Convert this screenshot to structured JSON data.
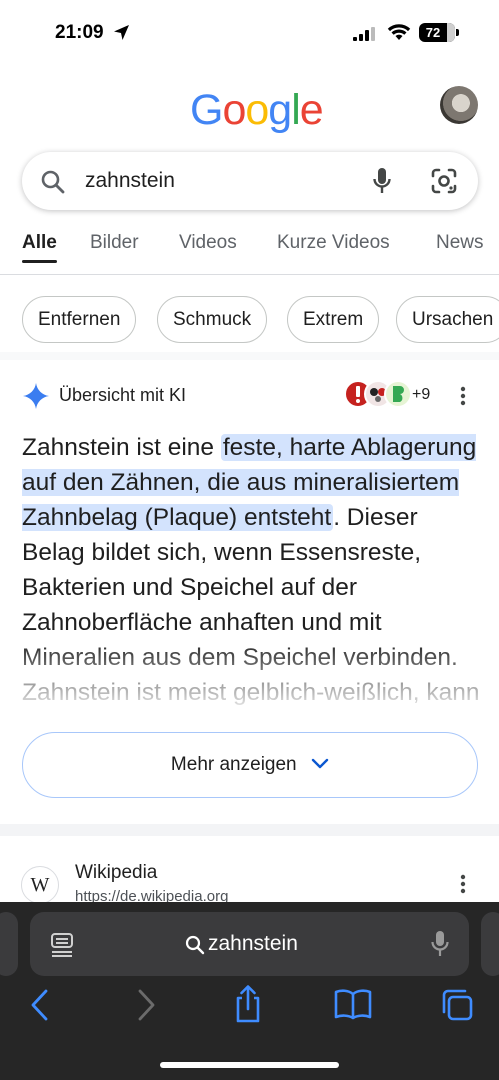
{
  "status_bar": {
    "time": "21:09",
    "battery": "72"
  },
  "header": {
    "logo": [
      "G",
      "o",
      "o",
      "g",
      "l",
      "e"
    ]
  },
  "search": {
    "query": "zahnstein"
  },
  "tabs": [
    {
      "label": "Alle",
      "active": true
    },
    {
      "label": "Bilder",
      "active": false
    },
    {
      "label": "Videos",
      "active": false
    },
    {
      "label": "Kurze Videos",
      "active": false
    },
    {
      "label": "News",
      "active": false
    }
  ],
  "chips": [
    "Entfernen",
    "Schmuck",
    "Extrem",
    "Ursachen"
  ],
  "ai_overview": {
    "title": "Übersicht mit KI",
    "source_count": "+9",
    "text_before": "Zahnstein ist eine ",
    "text_highlight": "feste, harte Ablagerung auf den Zähnen, die aus mineralisiertem Zahnbelag (Plaque) entsteht",
    "text_after": ". Dieser Belag bildet sich, wenn Essensreste, Bakterien und Speichel auf der Zahnoberfläche anhaften und mit Mineralien aus dem Speichel verbinden. Zahnstein ist meist gelblich-weißlich, kann aber",
    "more_button": "Mehr anzeigen"
  },
  "result": {
    "site_name": "Wikipedia",
    "url": "https://de.wikipedia.org"
  },
  "safari": {
    "address": "zahnstein"
  },
  "colors": {
    "highlight": "#d3e3fd",
    "accent_blue": "#4285f4",
    "safari_bar": "#262626",
    "safari_blue": "#3f8cff"
  }
}
